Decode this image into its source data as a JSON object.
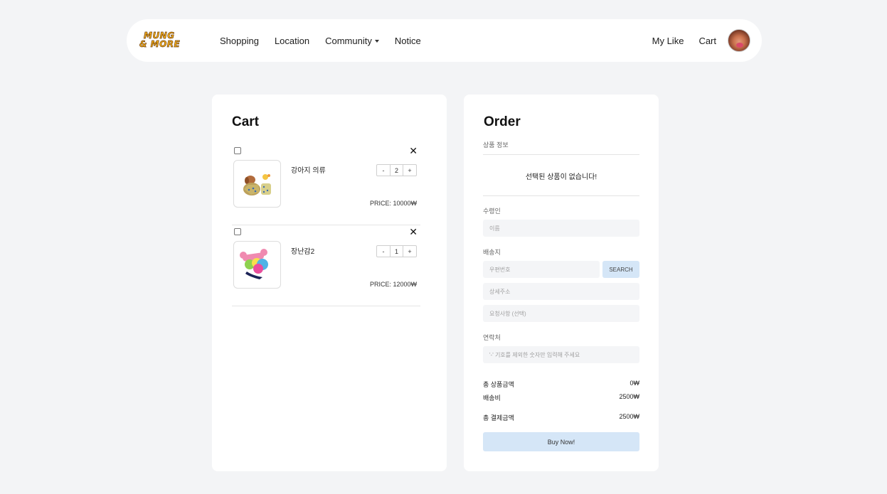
{
  "navbar": {
    "logo_line1": "MUNG",
    "logo_line2": "& MORE",
    "links": [
      "Shopping",
      "Location",
      "Community",
      "Notice"
    ],
    "right_links": [
      "My Like",
      "Cart"
    ]
  },
  "cart": {
    "title": "Cart",
    "remove_icon": "✕",
    "items": [
      {
        "name": "강아지 의류",
        "qty_minus": "-",
        "quantity": "2",
        "qty_plus": "+",
        "price": "PRICE: 10000₩",
        "image": "dog-clothing-photo"
      },
      {
        "name": "장난감2",
        "qty_minus": "-",
        "quantity": "1",
        "qty_plus": "+",
        "price": "PRICE: 12000₩",
        "image": "dog-toy-photo"
      }
    ]
  },
  "order": {
    "title": "Order",
    "product_info_label": "상품 정보",
    "empty_message": "선택된 상품이 없습니다!",
    "recipient_label": "수령인",
    "name_placeholder": "이름",
    "address_label": "배송지",
    "zipcode_placeholder": "우편번호",
    "search_label": "SEARCH",
    "detail_address_placeholder": "상세주소",
    "request_placeholder": "요청사항 (선택)",
    "contact_label": "연락처",
    "contact_placeholder": "'-' 기호를 제외한 숫자만 입력해 주세요",
    "subtotal_label": "총 상품금액",
    "subtotal_value": "0₩",
    "shipping_label": "배송비",
    "shipping_value": "2500₩",
    "total_label": "총 결제금액",
    "total_value": "2500₩",
    "buy_label": "Buy Now!"
  },
  "colors": {
    "page_bg": "#f3f4f6",
    "accent_button": "#d5e6f7",
    "logo": "#f7b21a"
  }
}
